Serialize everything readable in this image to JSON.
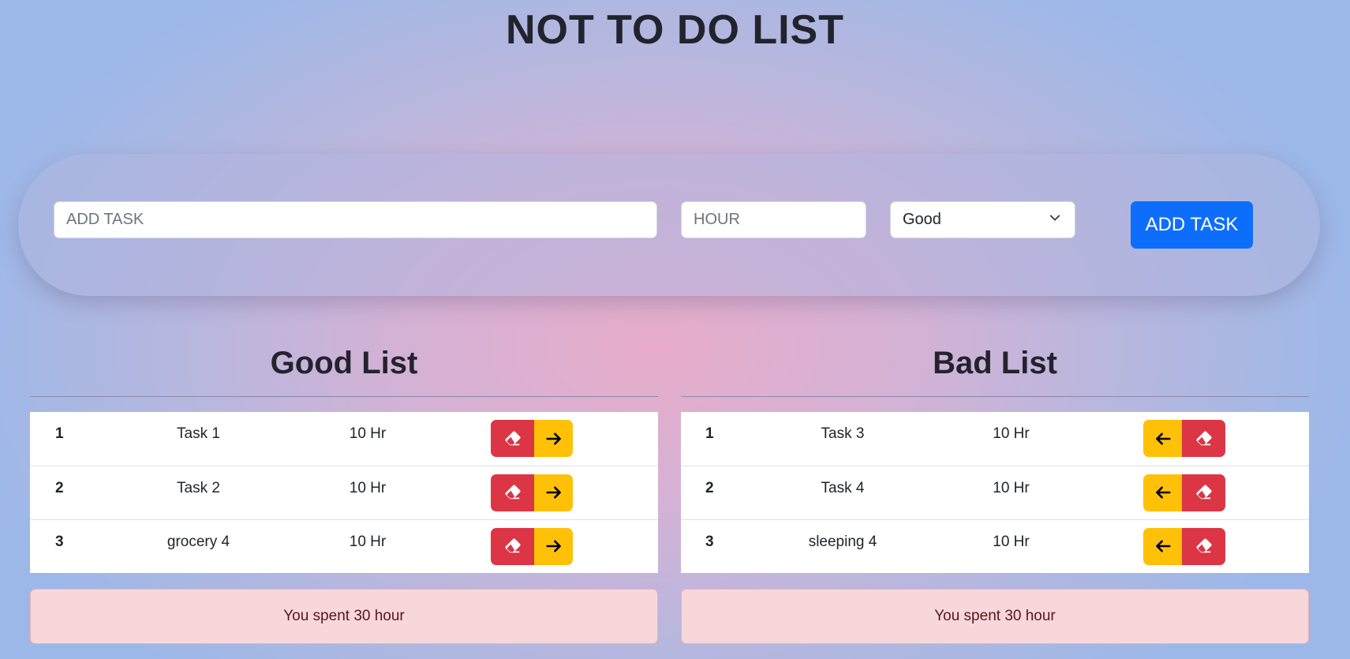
{
  "app": {
    "title": "NOT TO DO LIST"
  },
  "form": {
    "task_placeholder": "ADD TASK",
    "hour_placeholder": "HOUR",
    "type_selected": "Good",
    "add_button_label": "ADD TASK"
  },
  "good_list": {
    "title": "Good List",
    "rows": [
      {
        "num": "1",
        "task": "Task 1",
        "hours": "10 Hr"
      },
      {
        "num": "2",
        "task": "Task 2",
        "hours": "10 Hr"
      },
      {
        "num": "3",
        "task": "grocery 4",
        "hours": "10 Hr"
      }
    ],
    "summary": "You spent 30 hour"
  },
  "bad_list": {
    "title": "Bad List",
    "rows": [
      {
        "num": "1",
        "task": "Task 3",
        "hours": "10 Hr"
      },
      {
        "num": "2",
        "task": "Task 4",
        "hours": "10 Hr"
      },
      {
        "num": "3",
        "task": "sleeping 4",
        "hours": "10 Hr"
      }
    ],
    "summary": "You spent 30 hour"
  },
  "icons": {
    "delete": "eraser-icon",
    "move_right": "arrow-right-icon",
    "move_left": "arrow-left-icon",
    "dropdown": "chevron-down-icon"
  },
  "colors": {
    "primary": "#0d6efd",
    "danger": "#dc3545",
    "warning": "#ffc107",
    "alert_bg": "#f8d7da",
    "alert_text": "#58151c"
  }
}
